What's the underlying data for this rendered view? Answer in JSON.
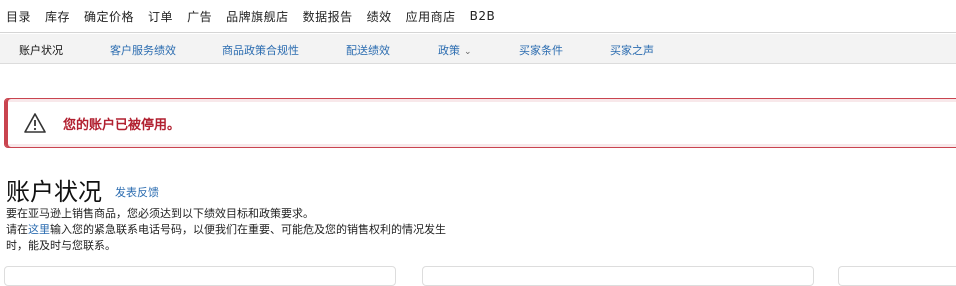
{
  "topnav": {
    "items": [
      "目录",
      "库存",
      "确定价格",
      "订单",
      "广告",
      "品牌旗舰店",
      "数据报告",
      "绩效",
      "应用商店",
      "B2B"
    ]
  },
  "subnav": {
    "items": [
      {
        "label": "账户状况",
        "active": true
      },
      {
        "label": "客户服务绩效"
      },
      {
        "label": "商品政策合规性"
      },
      {
        "label": "配送绩效"
      },
      {
        "label": "政策",
        "dropdown": true
      },
      {
        "label": "买家条件"
      },
      {
        "label": "买家之声"
      }
    ]
  },
  "alert": {
    "message": "您的账户已被停用。",
    "icon": "warning-triangle-icon",
    "color": "#c9444f"
  },
  "account_health": {
    "title": "账户状况",
    "feedback_link": "发表反馈",
    "line1": "要在亚马逊上销售商品，您必须达到以下绩效目标和政策要求。",
    "line2_prefix": "请在",
    "line2_link": "这里",
    "line2_suffix": "输入您的紧急联系电话号码，以便我们在重要、可能危及您的销售权利的情况发生",
    "line3": "时，能及时与您联系。"
  },
  "colors": {
    "link": "#2b6cb0",
    "alert_border": "#c9444f",
    "alert_text": "#b12030"
  }
}
